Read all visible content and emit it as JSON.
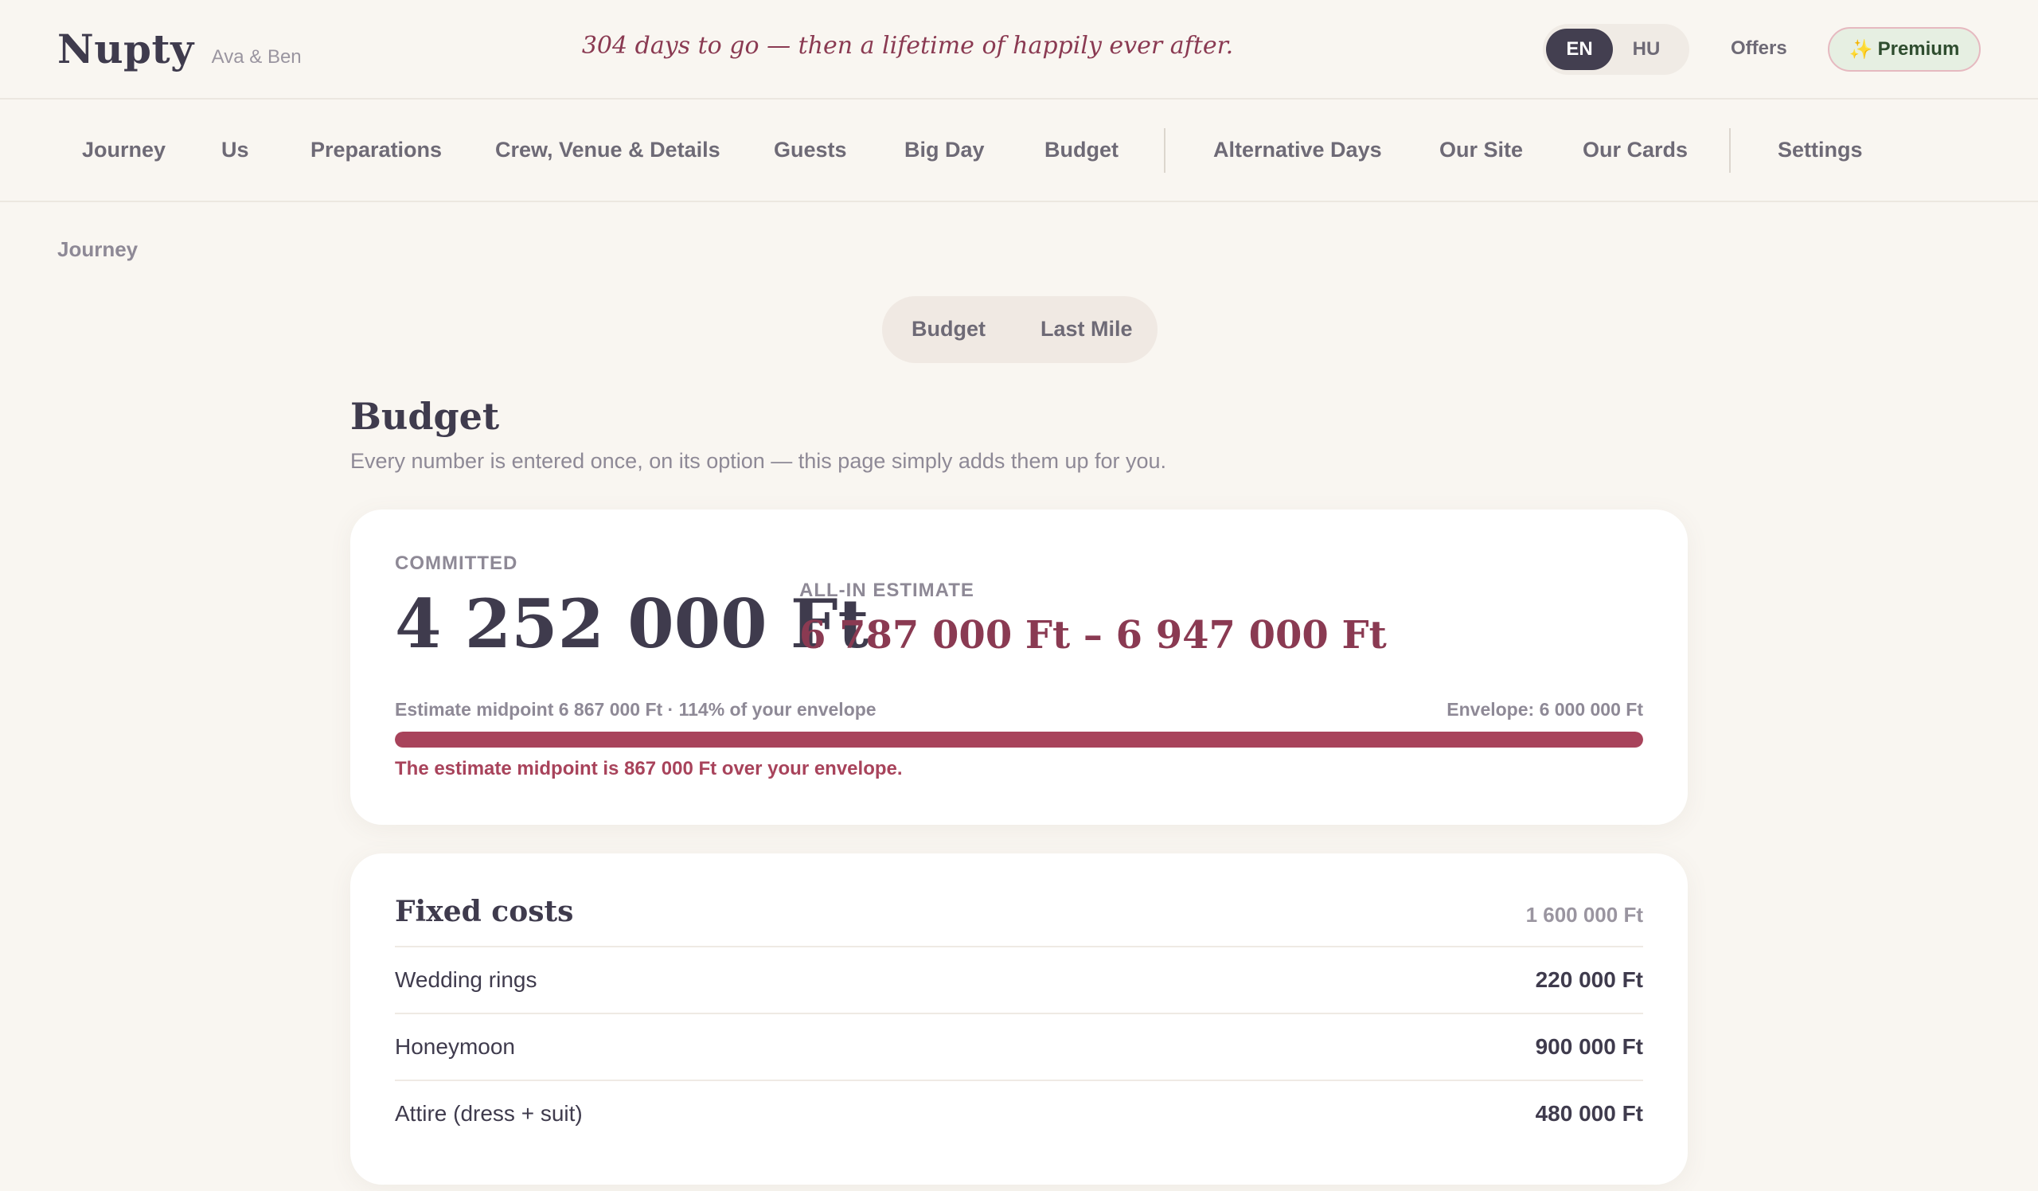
{
  "brand": {
    "name": "Nupty",
    "couple": "Ava & Ben"
  },
  "header": {
    "tagline": "304 days to go — then a lifetime of happily ever after.",
    "languages": [
      {
        "code": "EN",
        "active": true
      },
      {
        "code": "HU",
        "active": false
      }
    ],
    "offers_label": "Offers",
    "premium_icon": "✨",
    "premium_label": "Premium"
  },
  "nav": {
    "items": [
      "Journey",
      "Us",
      "Preparations",
      "Crew, Venue & Details",
      "Guests",
      "Big Day",
      "Budget",
      "Alternative Days",
      "Our Site",
      "Our Cards",
      "Settings"
    ]
  },
  "breadcrumb": "Journey",
  "segment": {
    "options": [
      "Budget",
      "Last Mile"
    ]
  },
  "page": {
    "title": "Budget",
    "subtitle": "Every number is entered once, on its option — this page simply adds them up for you."
  },
  "summary": {
    "committed_label": "COMMITTED",
    "committed_value": "4 252 000 Ft",
    "estimate_label": "ALL-IN ESTIMATE",
    "estimate_value": "6 787 000 Ft – 6 947 000 Ft",
    "midpoint_text": "Estimate midpoint 6 867 000 Ft · 114% of your envelope",
    "envelope_text": "Envelope: 6 000 000 Ft",
    "progress_fraction": 1.0,
    "warning": "The estimate midpoint is 867 000 Ft over your envelope.",
    "accent_color": "#a8435b"
  },
  "fixed_costs": {
    "title": "Fixed costs",
    "total": "1 600 000 Ft",
    "rows": [
      {
        "label": "Wedding rings",
        "value": "220 000 Ft"
      },
      {
        "label": "Honeymoon",
        "value": "900 000 Ft"
      },
      {
        "label": "Attire (dress + suit)",
        "value": "480 000 Ft"
      }
    ]
  }
}
